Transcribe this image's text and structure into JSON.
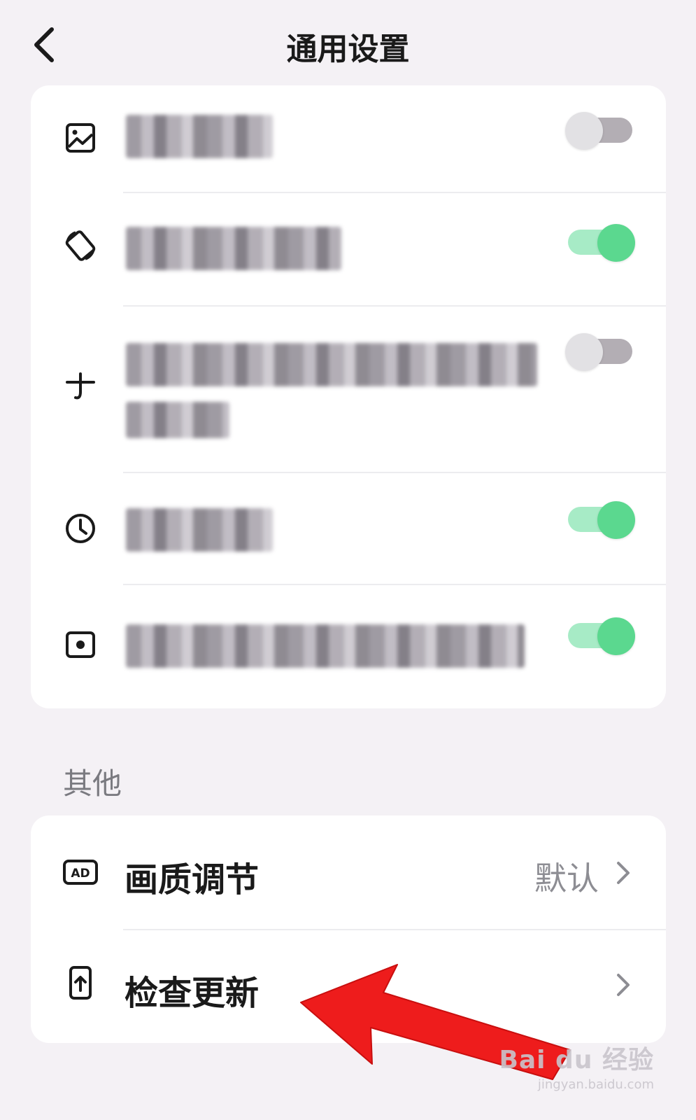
{
  "header": {
    "title": "通用设置",
    "back_icon": "chevron-left-icon"
  },
  "settings": [
    {
      "icon": "image-icon",
      "label_text": "",
      "toggle_on": false
    },
    {
      "icon": "rotate-screen-icon",
      "label_text": "",
      "toggle_on": true
    },
    {
      "icon": "shortcut-icon",
      "label_text": "",
      "toggle_on": false
    },
    {
      "icon": "clock-icon",
      "label_text": "",
      "toggle_on": true
    },
    {
      "icon": "screen-record-icon",
      "label_text": "",
      "toggle_on": true
    }
  ],
  "other_section": {
    "label": "其他",
    "items": [
      {
        "icon": "ad-icon",
        "label": "画质调节",
        "value": "默认",
        "chevron_icon": "chevron-right-icon"
      },
      {
        "icon": "phone-update-icon",
        "label": "检查更新",
        "value": "",
        "chevron_icon": "chevron-right-icon"
      }
    ]
  },
  "colors": {
    "toggle_on_knob": "#5bd88f",
    "toggle_on_track": "#a7ebc6",
    "toggle_off_knob": "#e2e1e4",
    "toggle_off_track": "#b3aeb4",
    "annotation_arrow": "#ee1c1c"
  },
  "watermark": {
    "logo": "Bai du 经验",
    "url": "jingyan.baidu.com"
  }
}
